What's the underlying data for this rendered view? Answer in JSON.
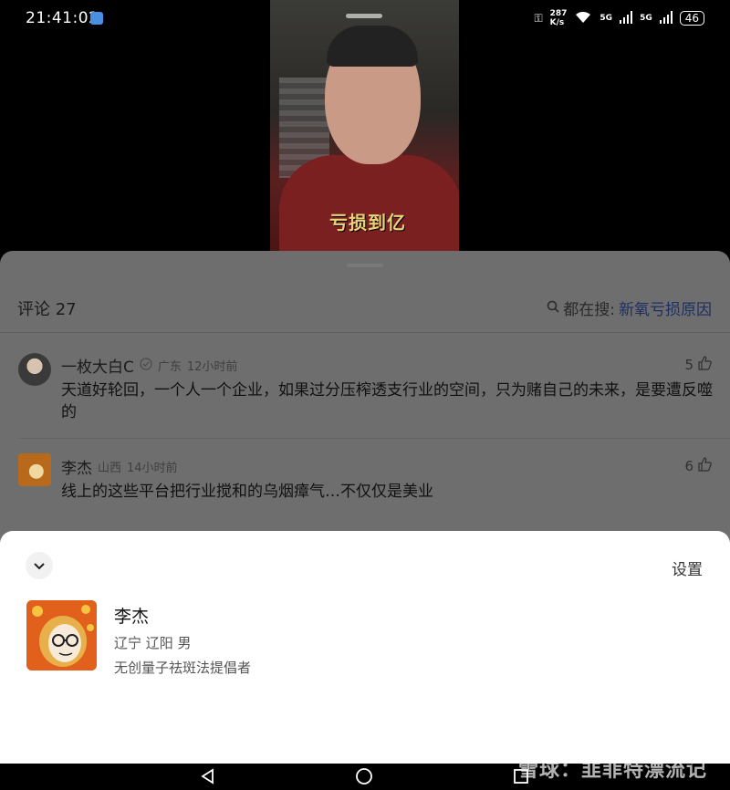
{
  "status_bar": {
    "time": "21:41:02",
    "net_speed": "287",
    "net_unit": "K/s",
    "signal1": "5G",
    "signal2": "5G",
    "battery": "46"
  },
  "video": {
    "caption": "亏损到亿"
  },
  "comments": {
    "title": "评论 27",
    "search_prefix": "都在搜:",
    "search_term": "新氧亏损原因",
    "items": [
      {
        "user": "一枚大白C",
        "location": "广东",
        "time": "12小时前",
        "likes": "5",
        "text": "天道好轮回，一个人一个企业，如果过分压榨透支行业的空间，只为赌自己的未来，是要遭反噬的"
      },
      {
        "user": "李杰",
        "location": "山西",
        "time": "14小时前",
        "likes": "6",
        "text": "线上的这些平台把行业搅和的乌烟瘴气…不仅仅是美业"
      }
    ]
  },
  "profile": {
    "settings_label": "设置",
    "name": "李杰",
    "location": "辽宁 辽阳 男",
    "bio": "无创量子祛斑法提倡者"
  },
  "watermark": "雪球：韭菲特漂流记",
  "icons": [
    "weather-icon",
    "key-icon",
    "wifi-icon",
    "signal-icon",
    "battery-icon",
    "search-icon",
    "verified-icon",
    "thumb-up-icon",
    "chevron-down-icon",
    "back-icon",
    "home-icon",
    "recents-icon"
  ]
}
